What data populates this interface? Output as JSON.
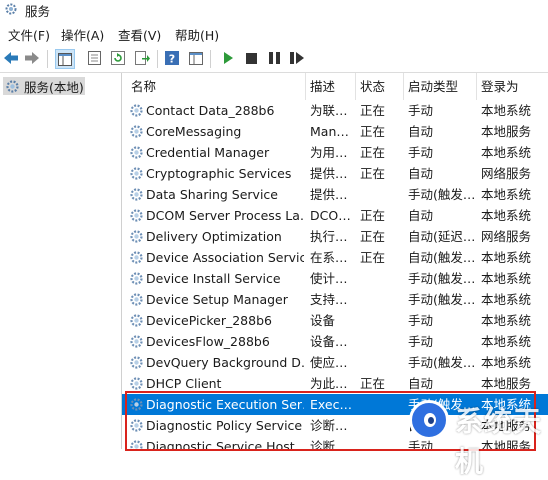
{
  "window": {
    "title": "服务"
  },
  "menu": [
    "文件(F)",
    "操作(A)",
    "查看(V)",
    "帮助(H)"
  ],
  "toolbar": {
    "icons": [
      "back-arrow-icon",
      "forward-arrow-icon",
      "console-tree-icon",
      "properties-icon",
      "refresh-icon",
      "export-icon",
      "help-icon",
      "view-icon",
      "play-icon",
      "stop-icon",
      "pause-icon",
      "restart-icon"
    ]
  },
  "tree": {
    "item": "服务(本地)"
  },
  "columns": {
    "name": "名称",
    "desc": "描述",
    "status": "状态",
    "startup": "启动类型",
    "logon": "登录为"
  },
  "services": [
    {
      "name": "Contact Data_288b6",
      "desc": "为联…",
      "status": "正在",
      "startup": "手动",
      "logon": "本地系统"
    },
    {
      "name": "CoreMessaging",
      "desc": "Man…",
      "status": "正在",
      "startup": "自动",
      "logon": "本地服务"
    },
    {
      "name": "Credential Manager",
      "desc": "为用…",
      "status": "正在",
      "startup": "手动",
      "logon": "本地系统"
    },
    {
      "name": "Cryptographic Services",
      "desc": "提供…",
      "status": "正在",
      "startup": "自动",
      "logon": "网络服务"
    },
    {
      "name": "Data Sharing Service",
      "desc": "提供…",
      "status": "",
      "startup": "手动(触发…",
      "logon": "本地系统"
    },
    {
      "name": "DCOM Server Process La…",
      "desc": "DCO…",
      "status": "正在",
      "startup": "自动",
      "logon": "本地系统"
    },
    {
      "name": "Delivery Optimization",
      "desc": "执行…",
      "status": "正在",
      "startup": "自动(延迟…",
      "logon": "网络服务"
    },
    {
      "name": "Device Association Service",
      "desc": "在系…",
      "status": "正在",
      "startup": "自动(触发…",
      "logon": "本地系统"
    },
    {
      "name": "Device Install Service",
      "desc": "使计…",
      "status": "",
      "startup": "手动(触发…",
      "logon": "本地系统"
    },
    {
      "name": "Device Setup Manager",
      "desc": "支持…",
      "status": "",
      "startup": "手动(触发…",
      "logon": "本地系统"
    },
    {
      "name": "DevicePicker_288b6",
      "desc": "设备",
      "status": "",
      "startup": "手动",
      "logon": "本地系统"
    },
    {
      "name": "DevicesFlow_288b6",
      "desc": "设备…",
      "status": "",
      "startup": "手动",
      "logon": "本地系统"
    },
    {
      "name": "DevQuery Background D…",
      "desc": "使应…",
      "status": "",
      "startup": "手动(触发…",
      "logon": "本地系统"
    },
    {
      "name": "DHCP Client",
      "desc": "为此…",
      "status": "正在",
      "startup": "自动",
      "logon": "本地服务"
    },
    {
      "name": "Diagnostic Execution Ser…",
      "desc": "Exec…",
      "status": "",
      "startup": "手动(触发…",
      "logon": "本地系统"
    },
    {
      "name": "Diagnostic Policy Service",
      "desc": "诊断…",
      "status": "",
      "startup": "自动",
      "logon": "本地服务"
    },
    {
      "name": "Diagnostic Service Host",
      "desc": "诊断…",
      "status": "",
      "startup": "手动",
      "logon": "本地服务"
    }
  ],
  "selected_row": 14,
  "watermark": {
    "text": "系统天机"
  }
}
